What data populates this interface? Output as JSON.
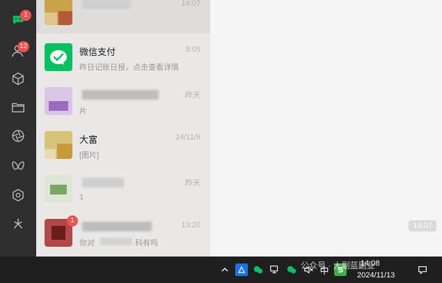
{
  "sidebar": {
    "items": [
      {
        "name": "chat-icon",
        "badge": "1"
      },
      {
        "name": "contacts-icon",
        "badge": "12"
      },
      {
        "name": "cube-icon",
        "badge": ""
      },
      {
        "name": "folder-icon",
        "badge": ""
      },
      {
        "name": "aperture-icon",
        "badge": ""
      },
      {
        "name": "butterfly-icon",
        "badge": ""
      },
      {
        "name": "hex-flower-icon",
        "badge": ""
      },
      {
        "name": "sparkle-icon",
        "badge": ""
      }
    ]
  },
  "chats": [
    {
      "name": "",
      "time": "14:07",
      "preview": "",
      "badge": ""
    },
    {
      "name": "微信支付",
      "time": "9:05",
      "preview": "昨日记账日报，点击查看详情",
      "badge": ""
    },
    {
      "name": "",
      "time": "昨天",
      "preview": "片",
      "badge": ""
    },
    {
      "name": "大富",
      "time": "24/11/9",
      "preview": "[图片]",
      "badge": ""
    },
    {
      "name": "",
      "time": "昨天",
      "preview": "1",
      "badge": ""
    },
    {
      "name": "",
      "time": "13:20",
      "preview": "你对",
      "preview2": "科有吗",
      "badge": "1"
    }
  ],
  "main": {
    "time_pill": "14:07"
  },
  "taskbar": {
    "time": "14:08",
    "date": "2024/11/13",
    "ime": "中",
    "watermark": "公众号 · 大副蓝副业"
  },
  "colors": {
    "wechat_pay_green": "#07c160",
    "badge_red": "#f44f4f"
  }
}
